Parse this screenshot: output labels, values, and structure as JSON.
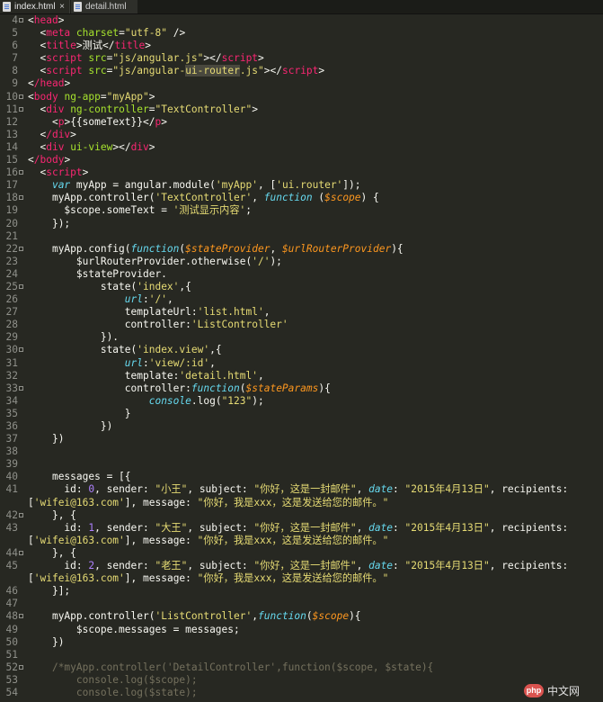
{
  "tabs": [
    {
      "label": "index.html",
      "close": "×"
    },
    {
      "label": "detail.html"
    }
  ],
  "lines": [
    {
      "n": "4"
    },
    {
      "n": "5"
    },
    {
      "n": "6"
    },
    {
      "n": "7"
    },
    {
      "n": "8"
    },
    {
      "n": "9"
    },
    {
      "n": "10"
    },
    {
      "n": "11"
    },
    {
      "n": "12"
    },
    {
      "n": "13"
    },
    {
      "n": "14"
    },
    {
      "n": "15"
    },
    {
      "n": "16"
    },
    {
      "n": "17"
    },
    {
      "n": "18"
    },
    {
      "n": "19"
    },
    {
      "n": "20"
    },
    {
      "n": "21"
    },
    {
      "n": "22"
    },
    {
      "n": "23"
    },
    {
      "n": "24"
    },
    {
      "n": "25"
    },
    {
      "n": "26"
    },
    {
      "n": "27"
    },
    {
      "n": "28"
    },
    {
      "n": "29"
    },
    {
      "n": "30"
    },
    {
      "n": "31"
    },
    {
      "n": "32"
    },
    {
      "n": "33"
    },
    {
      "n": "34"
    },
    {
      "n": "35"
    },
    {
      "n": "36"
    },
    {
      "n": "37"
    },
    {
      "n": "38"
    },
    {
      "n": "39"
    },
    {
      "n": "40"
    },
    {
      "n": "41"
    },
    {
      "n": ""
    },
    {
      "n": "42"
    },
    {
      "n": "43"
    },
    {
      "n": ""
    },
    {
      "n": "44"
    },
    {
      "n": "45"
    },
    {
      "n": ""
    },
    {
      "n": "46"
    },
    {
      "n": "47"
    },
    {
      "n": "48"
    },
    {
      "n": "49"
    },
    {
      "n": "50"
    },
    {
      "n": "51"
    },
    {
      "n": "52"
    },
    {
      "n": "53"
    },
    {
      "n": "54"
    }
  ],
  "code": {
    "l4": "head",
    "l5_tag": "meta",
    "l5_attr": "charset",
    "l5_val": "\"utf-8\"",
    "l6_title": "title",
    "l6_text": "测试",
    "l7_script": "script",
    "l7_src": "src",
    "l7_val": "\"js/angular.js\"",
    "l8_val_a": "\"js/angular-",
    "l8_val_sel": "ui-router",
    "l8_val_b": ".js\"",
    "l9": "/head",
    "l10_tag": "body",
    "l10_attr": "ng-app",
    "l10_val": "\"myApp\"",
    "l11_tag": "div",
    "l11_attr": "ng-controller",
    "l11_val": "\"TextController\"",
    "l12_tag": "p",
    "l12_text": "{{someText}}",
    "l13": "/div",
    "l14_tag": "div",
    "l14_attr": "ui-view",
    "l15": "/body",
    "l16": "script",
    "l17_var": "var",
    "l17_a": " myApp = angular.module(",
    "l17_s1": "'myApp'",
    "l17_b": ", [",
    "l17_s2": "'ui.router'",
    "l17_c": "]);",
    "l18_a": "myApp.controller(",
    "l18_s": "'TextController'",
    "l18_fn": "function",
    "l18_p": "$scope",
    "l19_a": "$scope.someText = ",
    "l19_s": "'测试显示内容'",
    "l20": "});",
    "l22_a": "myApp.config(",
    "l22_fn": "function",
    "l22_p1": "$stateProvider",
    "l22_p2": "$urlRouterProvider",
    "l23_a": "$urlRouterProvider.otherwise(",
    "l23_s": "'/'",
    "l23_b": ");",
    "l24": "$stateProvider.",
    "l25_a": "state(",
    "l25_s": "'index'",
    "l25_b": ",{",
    "l26_k": "url",
    "l26_s": "'/'",
    "l27_a": "templateUrl:",
    "l27_s": "'list.html'",
    "l28_a": "controller:",
    "l28_s": "'ListController'",
    "l29": "}).",
    "l30_s": "'index.view'",
    "l31_s": "'view/:id'",
    "l32_a": "template:",
    "l32_s": "'detail.html'",
    "l33_a": "controller:",
    "l33_p": "$stateParams",
    "l34_k": "console",
    "l34_a": ".log(",
    "l34_s": "\"123\"",
    "l34_b": ");",
    "l35": "}",
    "l36": "})",
    "l37": "})",
    "l40": "messages = [{",
    "m_id": "id: ",
    "m_sender": ", sender: ",
    "m_subject": ", subject: ",
    "m_date": "date",
    "m_recip": ", recipients:",
    "m_message": ", message: ",
    "m_subject_val": "\"你好，这是一封邮件\"",
    "m_date_val": "\"2015年4月13日\"",
    "m_recip_val": "'wifei@163.com'",
    "m_msg_val": "\"你好，我是xxx，这是发送给您的邮件。\"",
    "m0_id": "0",
    "m0_sender": "\"小王\"",
    "m1_id": "1",
    "m1_sender": "\"大王\"",
    "m2_id": "2",
    "m2_sender": "\"老王\"",
    "l42": "}, {",
    "l46": "}];",
    "l48_a": "myApp.controller(",
    "l48_s": "'ListController'",
    "l48_fn": "function",
    "l48_p": "$scope",
    "l48_b": "){",
    "l49": "$scope.messages = messages;",
    "l50": "})",
    "l52": "/*myApp.controller('DetailController',function($scope, $state){",
    "l53": "console.log($scope);",
    "l54": "console.log($state);"
  },
  "logo": {
    "badge": "php",
    "text": "中文网"
  },
  "colors": {
    "background": "#272822",
    "tag": "#f92672",
    "attribute": "#a6e22e",
    "string": "#e6db74",
    "keyword": "#66d9ef",
    "param": "#fd971f",
    "number": "#ae81ff",
    "comment": "#75715e"
  }
}
